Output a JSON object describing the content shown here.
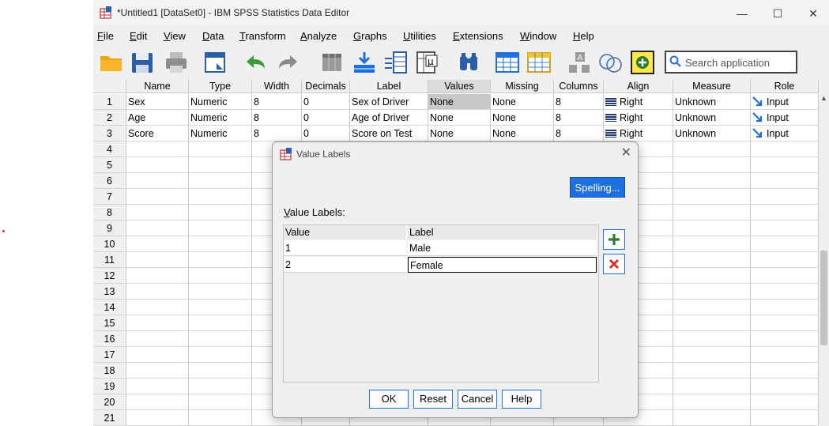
{
  "window": {
    "title": "*Untitled1 [DataSet0] - IBM SPSS Statistics Data Editor",
    "minimize": "—",
    "maximize": "☐",
    "close": "✕"
  },
  "menu": [
    {
      "label_u": "F",
      "label_rest": "ile"
    },
    {
      "label_u": "E",
      "label_rest": "dit"
    },
    {
      "label_u": "V",
      "label_rest": "iew"
    },
    {
      "label_u": "D",
      "label_rest": "ata"
    },
    {
      "label_u": "T",
      "label_rest": "ransform"
    },
    {
      "label_u": "A",
      "label_rest": "nalyze"
    },
    {
      "label_u": "G",
      "label_rest": "raphs"
    },
    {
      "label_u": "U",
      "label_rest": "tilities"
    },
    {
      "label_u": "E",
      "label_rest": "xtensions"
    },
    {
      "label_u": "W",
      "label_rest": "indow"
    },
    {
      "label_u": "H",
      "label_rest": "elp"
    }
  ],
  "search": {
    "placeholder": "Search application"
  },
  "columns": [
    "Name",
    "Type",
    "Width",
    "Decimals",
    "Label",
    "Values",
    "Missing",
    "Columns",
    "Align",
    "Measure",
    "Role"
  ],
  "rows": [
    {
      "num": "1",
      "name": "Sex",
      "type": "Numeric",
      "width": "8",
      "decimals": "0",
      "label": "Sex of Driver",
      "values": "None",
      "missing": "None",
      "columns": "8",
      "align": "Right",
      "measure": "Unknown",
      "role": "Input"
    },
    {
      "num": "2",
      "name": "Age",
      "type": "Numeric",
      "width": "8",
      "decimals": "0",
      "label": "Age of Driver",
      "values": "None",
      "missing": "None",
      "columns": "8",
      "align": "Right",
      "measure": "Unknown",
      "role": "Input"
    },
    {
      "num": "3",
      "name": "Score",
      "type": "Numeric",
      "width": "8",
      "decimals": "0",
      "label": "Score on Test",
      "values": "None",
      "missing": "None",
      "columns": "8",
      "align": "Right",
      "measure": "Unknown",
      "role": "Input"
    }
  ],
  "empty_rows": [
    "4",
    "5",
    "6",
    "7",
    "8",
    "9",
    "10",
    "11",
    "12",
    "13",
    "14",
    "15",
    "16",
    "17",
    "18",
    "19",
    "20",
    "21"
  ],
  "dialog": {
    "title": "Value Labels",
    "spelling": "Spelling...",
    "section_u": "V",
    "section_rest": "alue Labels:",
    "col_value": "Value",
    "col_label": "Label",
    "entries": [
      {
        "value": "1",
        "label": "Male"
      },
      {
        "value": "2",
        "label": "Female"
      }
    ],
    "buttons": {
      "ok": "OK",
      "reset": "Reset",
      "cancel": "Cancel",
      "help": "Help"
    }
  },
  "colors": {
    "accent": "#1e6fe0",
    "add": "#2e7d32",
    "delete": "#d32f2f"
  }
}
